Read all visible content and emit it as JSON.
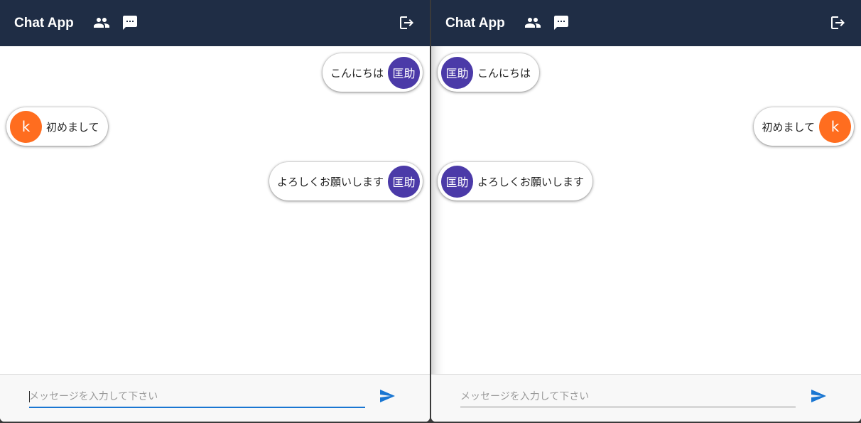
{
  "colors": {
    "appbar": "#1f2d45",
    "accent": "#1976d2",
    "avatar_k": "#ff6d1f",
    "avatar_kyosuke": "#4b3aa8"
  },
  "panes": [
    {
      "title": "Chat App",
      "icons": {
        "people": "people-icon",
        "chat": "chat-icon",
        "logout": "logout-icon",
        "send": "send-icon"
      },
      "messages": [
        {
          "text": "こんにちは",
          "avatar": "匡助",
          "own": true
        },
        {
          "text": "初めまして",
          "avatar": "k",
          "own": false
        },
        {
          "text": "よろしくお願いします",
          "avatar": "匡助",
          "own": true
        }
      ],
      "input": {
        "placeholder": "メッセージを入力して下さい",
        "value": "",
        "focused": true
      }
    },
    {
      "title": "Chat App",
      "icons": {
        "people": "people-icon",
        "chat": "chat-icon",
        "logout": "logout-icon",
        "send": "send-icon"
      },
      "messages": [
        {
          "text": "こんにちは",
          "avatar": "匡助",
          "own": false
        },
        {
          "text": "初めまして",
          "avatar": "k",
          "own": true
        },
        {
          "text": "よろしくお願いします",
          "avatar": "匡助",
          "own": false
        }
      ],
      "input": {
        "placeholder": "メッセージを入力して下さい",
        "value": "",
        "focused": false
      }
    }
  ]
}
